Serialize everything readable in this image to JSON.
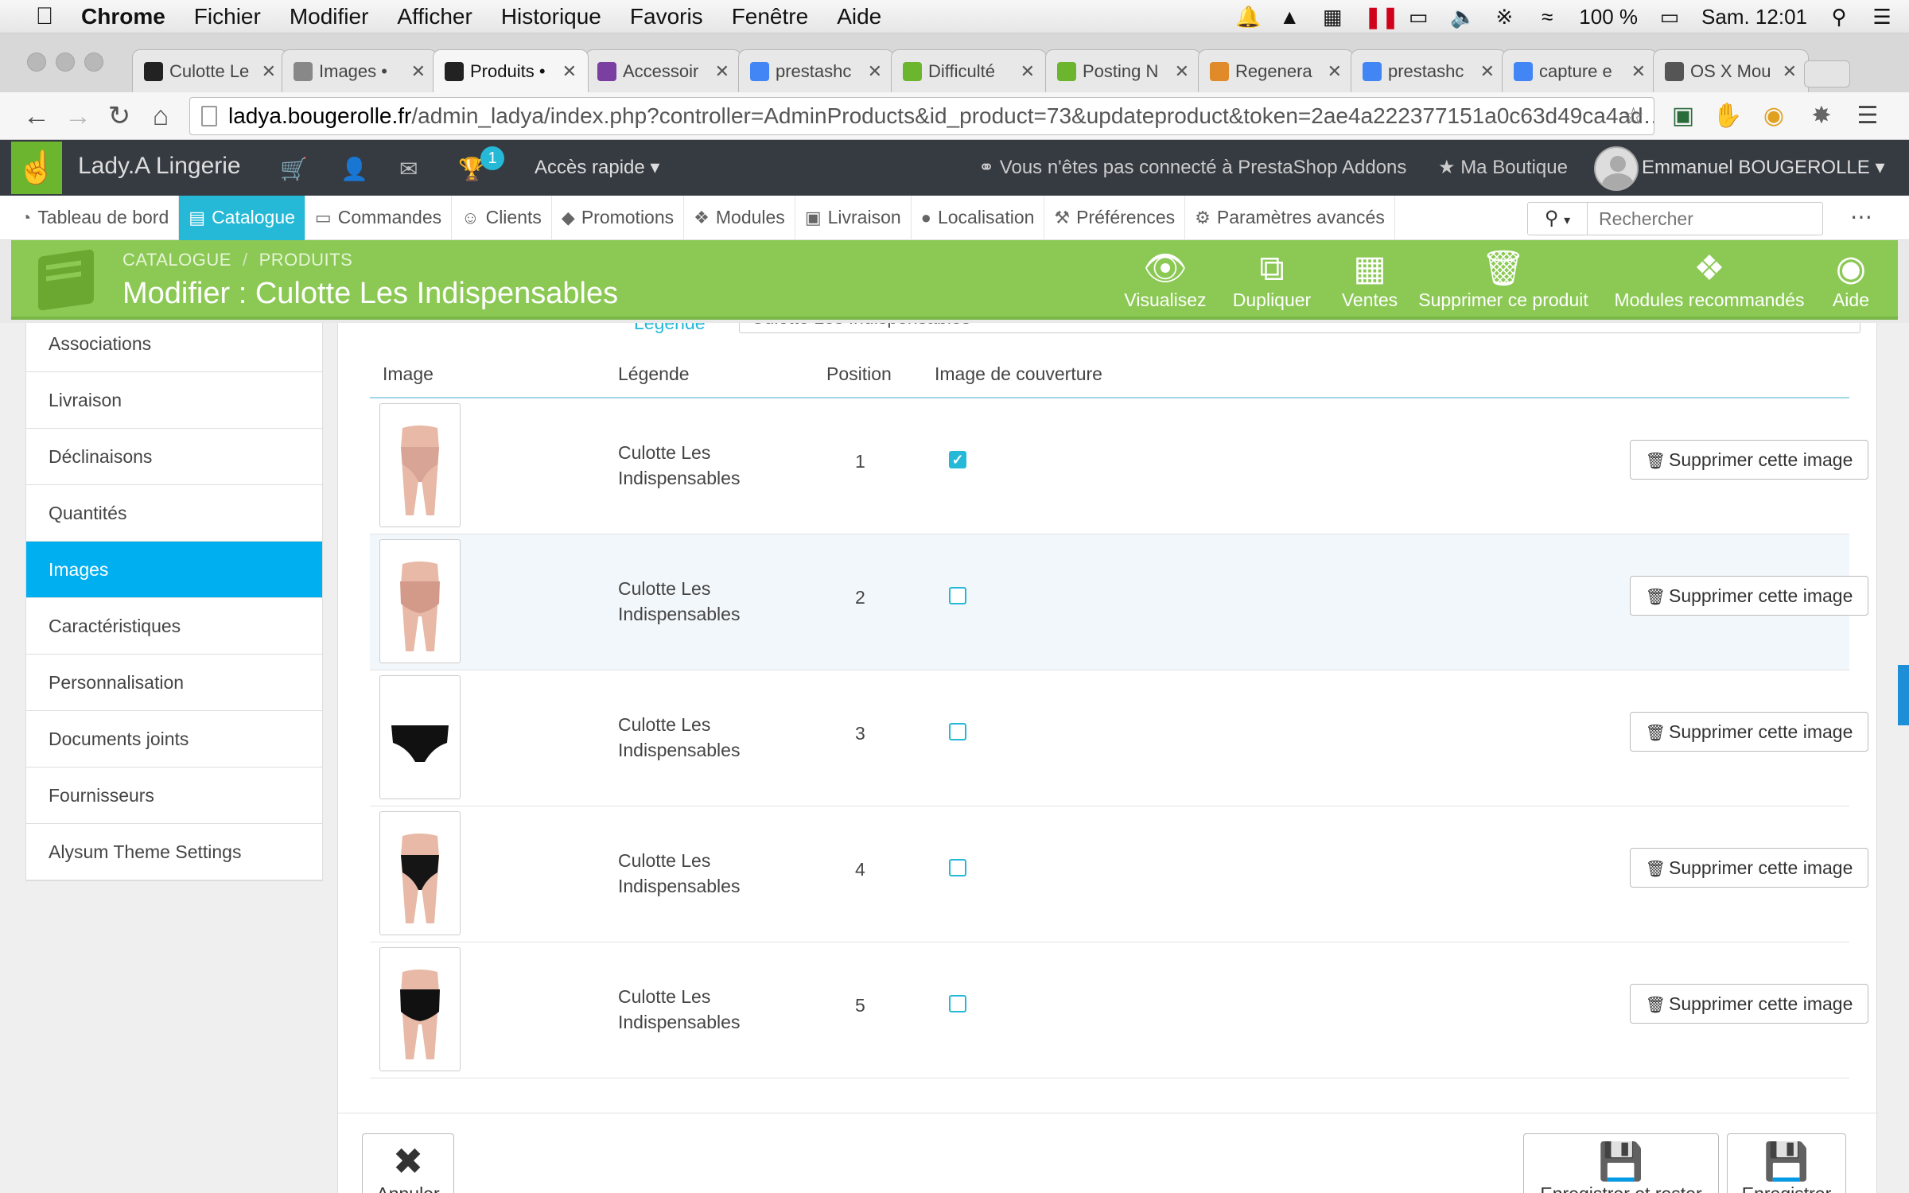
{
  "menubar": {
    "app": "Chrome",
    "items": [
      "Fichier",
      "Modifier",
      "Afficher",
      "Historique",
      "Favoris",
      "Fenêtre",
      "Aide"
    ],
    "battery": "100 %",
    "clock": "Sam. 12:01"
  },
  "browser": {
    "tabs": [
      {
        "title": "Culotte Le",
        "favicon_color": "#222222"
      },
      {
        "title": "Images •",
        "favicon_color": "#888888"
      },
      {
        "title": "Produits •",
        "favicon_color": "#222222"
      },
      {
        "title": "Accessoir",
        "favicon_color": "#7a3fa0"
      },
      {
        "title": "prestashc",
        "favicon_color": "#4285f4"
      },
      {
        "title": "Difficulté",
        "favicon_color": "#6cb52e"
      },
      {
        "title": "Posting N",
        "favicon_color": "#6cb52e"
      },
      {
        "title": "Regenera",
        "favicon_color": "#e08a2a"
      },
      {
        "title": "prestashc",
        "favicon_color": "#4285f4"
      },
      {
        "title": "capture e",
        "favicon_color": "#4285f4"
      },
      {
        "title": "OS X Mou",
        "favicon_color": "#555555"
      }
    ],
    "url_host": "ladya.bougerolle.fr",
    "url_path": "/admin_ladya/index.php?controller=AdminProducts&id_product=73&updateproduct&token=2ae4a222377151a0c63d49ca4ad…"
  },
  "header": {
    "shop_name": "Lady.A Lingerie",
    "badge_count": "1",
    "quick_access": "Accès rapide",
    "addons_status": "Vous n'êtes pas connecté à PrestaShop Addons",
    "my_shop": "Ma Boutique",
    "user_name": "Emmanuel BOUGEROLLE"
  },
  "nav": {
    "items": [
      {
        "label": "Tableau de bord",
        "icon": "dashboard-icon"
      },
      {
        "label": "Catalogue",
        "icon": "book-icon"
      },
      {
        "label": "Commandes",
        "icon": "credit-card-icon"
      },
      {
        "label": "Clients",
        "icon": "users-icon"
      },
      {
        "label": "Promotions",
        "icon": "tag-icon"
      },
      {
        "label": "Modules",
        "icon": "puzzle-icon"
      },
      {
        "label": "Livraison",
        "icon": "truck-icon"
      },
      {
        "label": "Localisation",
        "icon": "globe-icon"
      },
      {
        "label": "Préférences",
        "icon": "wrench-icon"
      },
      {
        "label": "Paramètres avancés",
        "icon": "cogs-icon"
      }
    ],
    "active_index": 1,
    "search_placeholder": "Rechercher"
  },
  "toolbar": {
    "breadcrumb": [
      "CATALOGUE",
      "PRODUITS"
    ],
    "title": "Modifier : Culotte Les Indispensables",
    "buttons": [
      {
        "label": "Visualisez",
        "icon": "eye-icon"
      },
      {
        "label": "Dupliquer",
        "icon": "copy-icon"
      },
      {
        "label": "Ventes",
        "icon": "bar-chart-icon"
      },
      {
        "label": "Supprimer ce produit",
        "icon": "trash-icon"
      },
      {
        "label": "Modules recommandés",
        "icon": "puzzle-icon"
      },
      {
        "label": "Aide",
        "icon": "lifebuoy-icon"
      }
    ]
  },
  "sidebar": {
    "items": [
      "Associations",
      "Livraison",
      "Déclinaisons",
      "Quantités",
      "Images",
      "Caractéristiques",
      "Personnalisation",
      "Documents joints",
      "Fournisseurs",
      "Alysum Theme Settings"
    ],
    "active_index": 4
  },
  "images_panel": {
    "legend_label": "Légende",
    "legend_value": "Culotte Les Indispensables",
    "columns": [
      "Image",
      "Légende",
      "Position",
      "Image de couverture"
    ],
    "rows": [
      {
        "legend": "Culotte Les Indispensables",
        "position": "1",
        "cover": true,
        "thumb": "nude-front"
      },
      {
        "legend": "Culotte Les Indispensables",
        "position": "2",
        "cover": false,
        "thumb": "nude-back"
      },
      {
        "legend": "Culotte Les Indispensables",
        "position": "3",
        "cover": false,
        "thumb": "black-flat"
      },
      {
        "legend": "Culotte Les Indispensables",
        "position": "4",
        "cover": false,
        "thumb": "black-front"
      },
      {
        "legend": "Culotte Les Indispensables",
        "position": "5",
        "cover": false,
        "thumb": "black-back"
      }
    ],
    "delete_label": "Supprimer cette image",
    "cancel_label": "Annuler",
    "save_stay_label": "Enregistrer et rester",
    "save_label": "Enregistrer"
  }
}
